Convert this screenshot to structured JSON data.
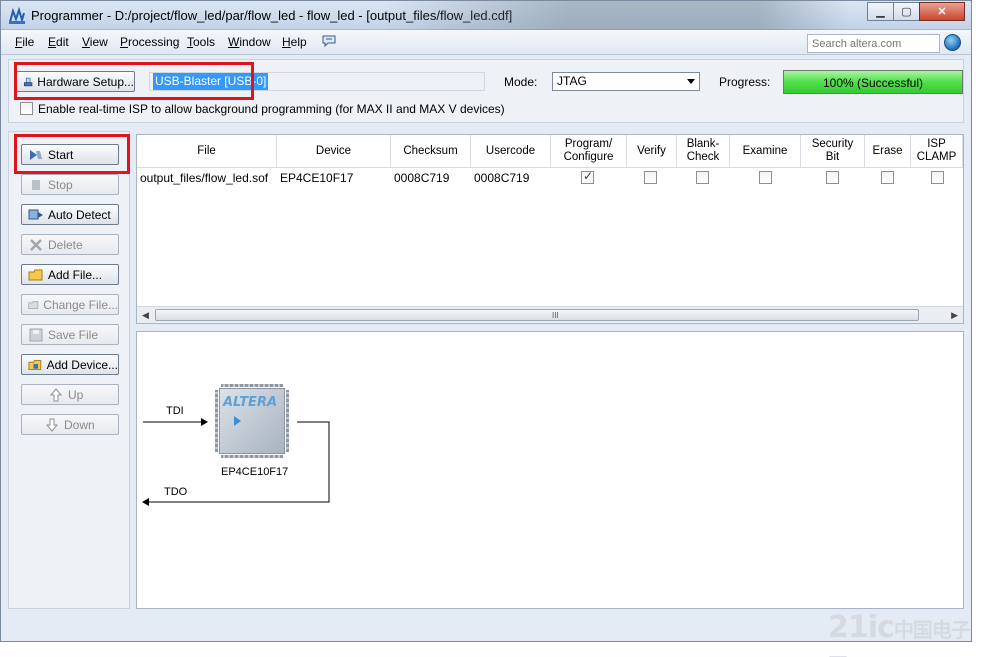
{
  "window": {
    "title": "Programmer - D:/project/flow_led/par/flow_led - flow_led - [output_files/flow_led.cdf]",
    "minimize": "▁",
    "maximize": "▢",
    "close": "✕"
  },
  "menu": {
    "items": [
      {
        "label": "File",
        "key": "F",
        "rest": "ile"
      },
      {
        "label": "Edit",
        "key": "E",
        "rest": "dit"
      },
      {
        "label": "View",
        "key": "V",
        "rest": "iew"
      },
      {
        "label": "Processing",
        "key": "P",
        "rest": "rocessing"
      },
      {
        "label": "Tools",
        "key": "T",
        "rest": "ools"
      },
      {
        "label": "Window",
        "key": "W",
        "rest": "indow"
      },
      {
        "label": "Help",
        "key": "H",
        "rest": "elp"
      }
    ],
    "search_placeholder": "Search altera.com"
  },
  "hardware": {
    "setup_button": "Hardware Setup...",
    "device": "USB-Blaster [USB-0]",
    "mode_label": "Mode:",
    "mode_value": "JTAG",
    "progress_label": "Progress:",
    "progress_value": 1.0,
    "progress_text": "100% (Successful)",
    "isp_checkbox_label": "Enable real-time ISP to allow background programming (for MAX II and MAX V devices)",
    "isp_checked": false
  },
  "sidebar": {
    "buttons": [
      {
        "label": "Start",
        "enabled": true
      },
      {
        "label": "Stop",
        "enabled": false
      },
      {
        "label": "Auto Detect",
        "enabled": true
      },
      {
        "label": "Delete",
        "enabled": false
      },
      {
        "label": "Add File...",
        "enabled": true
      },
      {
        "label": "Change File...",
        "enabled": false
      },
      {
        "label": "Save File",
        "enabled": false
      },
      {
        "label": "Add Device...",
        "enabled": true
      },
      {
        "label": "Up",
        "enabled": false
      },
      {
        "label": "Down",
        "enabled": false
      }
    ]
  },
  "table": {
    "columns": [
      "File",
      "Device",
      "Checksum",
      "Usercode",
      "Program/ Configure",
      "Verify",
      "Blank- Check",
      "Examine",
      "Security Bit",
      "Erase",
      "ISP CLAMP"
    ],
    "rows": [
      {
        "file": "output_files/flow_led.sof",
        "device": "EP4CE10F17",
        "checksum": "0008C719",
        "usercode": "0008C719",
        "program": true,
        "verify": false,
        "blank_check": false,
        "examine": false,
        "security_bit": false,
        "erase": false,
        "isp_clamp": false
      }
    ],
    "scroll_grip": "III"
  },
  "chain": {
    "tdi_label": "TDI",
    "tdo_label": "TDO",
    "chip_logo": "ALTERA",
    "chip_name": "EP4CE10F17"
  },
  "watermark": {
    "main": "21ic",
    "sub": "中国电子网"
  },
  "colors": {
    "highlight": "#e0141e",
    "progress_green": "#4fe04a",
    "selection_blue": "#3399ff"
  }
}
